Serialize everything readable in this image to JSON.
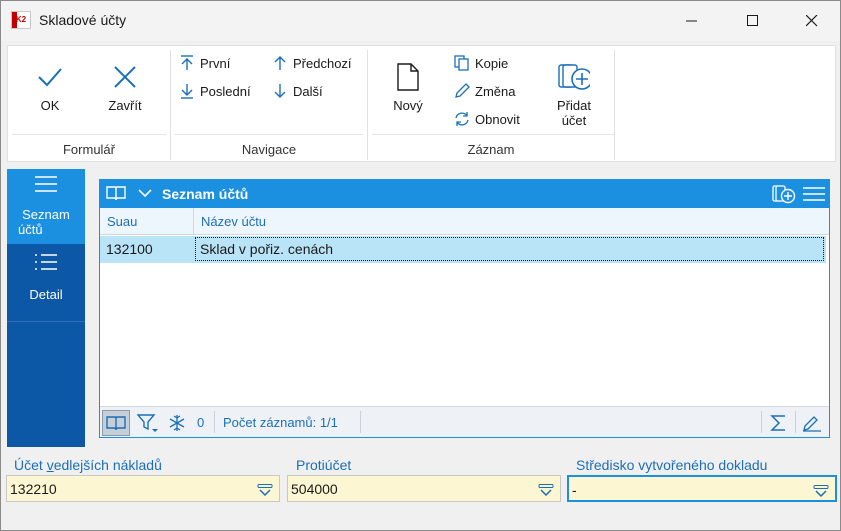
{
  "window": {
    "title": "Skladové účty",
    "logo_text": "K2"
  },
  "ribbon": {
    "groups": {
      "formular": "Formulář",
      "navigace": "Navigace",
      "zaznam": "Záznam"
    },
    "buttons": {
      "ok": "OK",
      "close": "Zavřít",
      "first": "První",
      "last": "Poslední",
      "previous": "Předchozí",
      "next": "Další",
      "new": "Nový",
      "copy": "Kopie",
      "change": "Změna",
      "refresh": "Obnovit",
      "add_account_line1": "Přidat",
      "add_account_line2": "účet"
    }
  },
  "leftnav": {
    "items": [
      {
        "label_line1": "Seznam",
        "label_line2": "účtů",
        "active": true
      },
      {
        "label_line1": "Detail",
        "label_line2": "",
        "active": false
      }
    ]
  },
  "panel": {
    "title": "Seznam účtů",
    "columns": [
      "Suau",
      "Název účtu"
    ],
    "rows": [
      [
        "132100",
        "Sklad v pořiz. cenách"
      ]
    ],
    "filter_count": "0",
    "record_count": "Počet záznamů: 1/1"
  },
  "fields": {
    "secondary_costs": {
      "label_prefix": "Účet ",
      "label_underlined": "v",
      "label_rest": "edlejších nákladů",
      "value": "132210"
    },
    "counter_account": {
      "label": "Protiúčet",
      "value": "504000"
    },
    "cost_center": {
      "label": "Středisko vytvořeného dokladu",
      "value": "-"
    }
  },
  "colors": {
    "accent": "#1b8fe0",
    "nav_dark": "#0d57a7",
    "selected_row": "#b9e3f7",
    "field_bg": "#fdf6d3"
  }
}
